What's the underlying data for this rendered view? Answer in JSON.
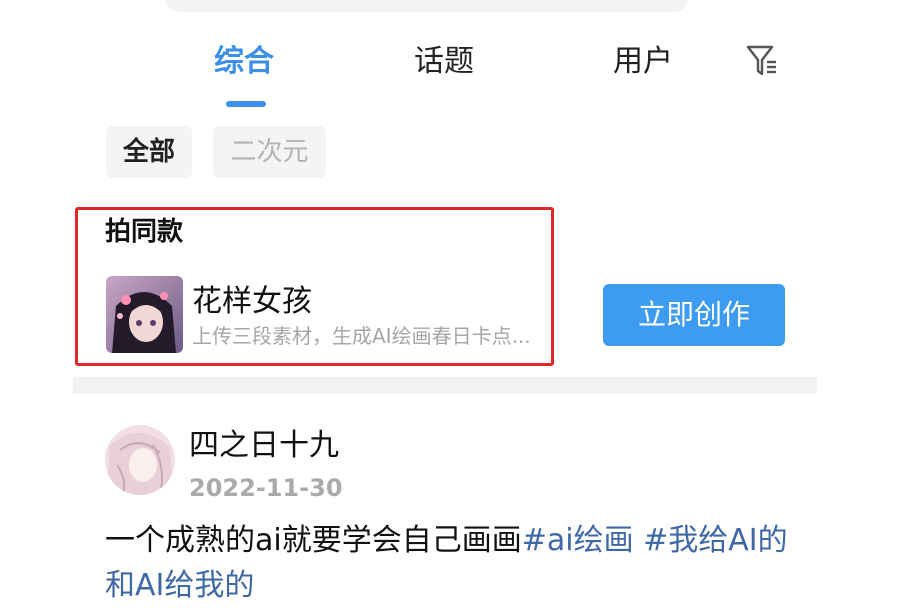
{
  "tabs": [
    {
      "label": "综合",
      "active": true
    },
    {
      "label": "话题",
      "active": false
    },
    {
      "label": "用户",
      "active": false
    }
  ],
  "filter": {
    "icon": "filter-icon"
  },
  "chips": [
    {
      "label": "全部",
      "selected": true
    },
    {
      "label": "二次元",
      "selected": false
    }
  ],
  "same_style": {
    "section_title": "拍同款",
    "item": {
      "title": "花样女孩",
      "description": "上传三段素材，生成AI绘画春日卡点...",
      "button_label": "立即创作"
    }
  },
  "post": {
    "username": "四之日十九",
    "date": "2022-11-30",
    "text_prefix": "一个成熟的ai就要学会自己画画",
    "hashtag1": "#ai绘画",
    "hashtag2": "#我给AI的",
    "line2": "和AI给我的"
  },
  "colors": {
    "accent": "#3b8fe8",
    "button": "#3d9bf2",
    "highlight_box": "#e0262a",
    "hashtag": "#3f68a8"
  }
}
